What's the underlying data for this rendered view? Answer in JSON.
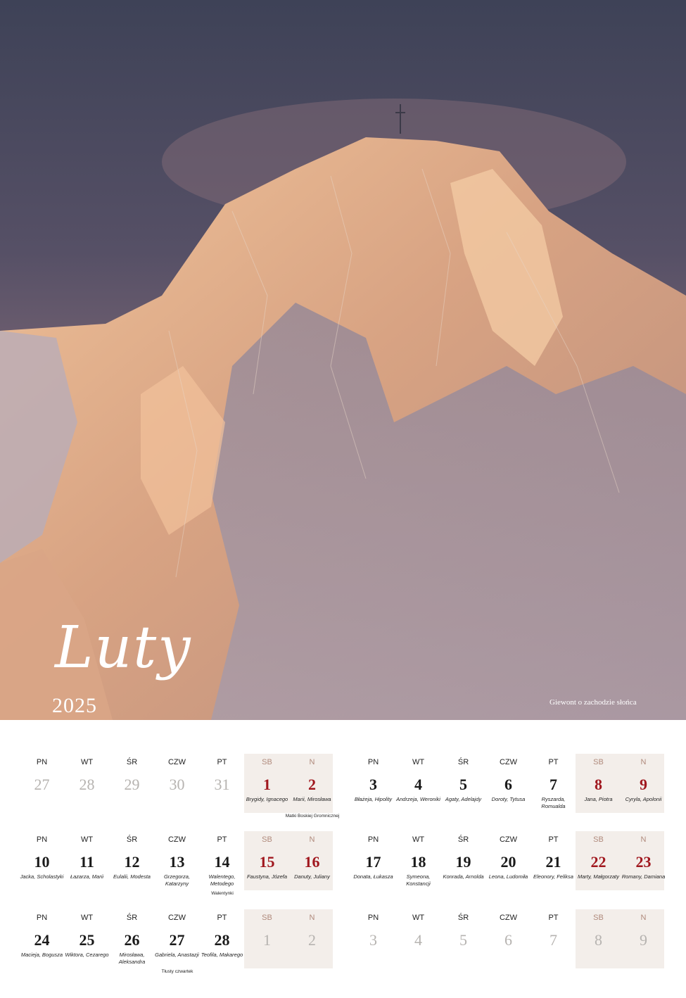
{
  "month": "Luty",
  "year": "2025",
  "caption": "Giewont o zachodzie słońca",
  "colors": {
    "sky": "#4b4f64",
    "rock_light": "#e9b88f",
    "weekend_bg": "#f3eeea",
    "holiday_red": "#a0171e",
    "dim_gray": "#b6b3b0"
  },
  "weekdays": [
    "PN",
    "WT",
    "ŚR",
    "CZW",
    "PT",
    "SB",
    "N"
  ],
  "weeks": [
    {
      "days": [
        {
          "n": "27",
          "names": "",
          "style": "gray"
        },
        {
          "n": "28",
          "names": "",
          "style": "gray"
        },
        {
          "n": "29",
          "names": "",
          "style": "gray"
        },
        {
          "n": "30",
          "names": "",
          "style": "gray"
        },
        {
          "n": "31",
          "names": "",
          "style": "gray"
        },
        {
          "n": "1",
          "names": "Brygidy, Ignacego",
          "style": "red"
        },
        {
          "n": "2",
          "names": "Marii, Mirosława",
          "style": "red"
        }
      ],
      "note": {
        "day": 6,
        "text": "Matki Boskiej Gromnicznej"
      }
    },
    {
      "days": [
        {
          "n": "3",
          "names": "Błażeja, Hipolity",
          "style": "normal"
        },
        {
          "n": "4",
          "names": "Andrzeja, Weroniki",
          "style": "normal"
        },
        {
          "n": "5",
          "names": "Agaty, Adelajdy",
          "style": "normal"
        },
        {
          "n": "6",
          "names": "Doroty, Tytusa",
          "style": "normal"
        },
        {
          "n": "7",
          "names": "Ryszarda, Romualda",
          "style": "normal"
        },
        {
          "n": "8",
          "names": "Jana, Piotra",
          "style": "red"
        },
        {
          "n": "9",
          "names": "Cyryla, Apolonii",
          "style": "red"
        }
      ]
    },
    {
      "days": [
        {
          "n": "10",
          "names": "Jacka, Scholastyki",
          "style": "normal"
        },
        {
          "n": "11",
          "names": "Łazarza, Marii",
          "style": "normal"
        },
        {
          "n": "12",
          "names": "Eulalii, Modesta",
          "style": "normal"
        },
        {
          "n": "13",
          "names": "Grzegorza, Katarzyny",
          "style": "normal"
        },
        {
          "n": "14",
          "names": "Walentego, Metodego",
          "style": "normal"
        },
        {
          "n": "15",
          "names": "Faustyna, Józefa",
          "style": "red"
        },
        {
          "n": "16",
          "names": "Danuty, Juliany",
          "style": "red"
        }
      ],
      "note": {
        "day": 4,
        "text": "Walentynki"
      }
    },
    {
      "days": [
        {
          "n": "17",
          "names": "Donata, Łukasza",
          "style": "normal"
        },
        {
          "n": "18",
          "names": "Symeona, Konstancji",
          "style": "normal"
        },
        {
          "n": "19",
          "names": "Konrada, Arnolda",
          "style": "normal"
        },
        {
          "n": "20",
          "names": "Leona, Ludomiła",
          "style": "normal"
        },
        {
          "n": "21",
          "names": "Eleonory, Feliksa",
          "style": "normal"
        },
        {
          "n": "22",
          "names": "Marty, Małgorzaty",
          "style": "red"
        },
        {
          "n": "23",
          "names": "Romany, Damiana",
          "style": "red"
        }
      ]
    },
    {
      "days": [
        {
          "n": "24",
          "names": "Macieja, Bogusza",
          "style": "normal"
        },
        {
          "n": "25",
          "names": "Wiktora, Cezarego",
          "style": "normal"
        },
        {
          "n": "26",
          "names": "Mirosława, Aleksandra",
          "style": "normal"
        },
        {
          "n": "27",
          "names": "Gabriela, Anastazji",
          "style": "normal"
        },
        {
          "n": "28",
          "names": "Teofila, Makarego",
          "style": "normal"
        },
        {
          "n": "1",
          "names": "",
          "style": "gray"
        },
        {
          "n": "2",
          "names": "",
          "style": "gray"
        }
      ],
      "note": {
        "day": 3,
        "text": "Tłusty czwartek"
      }
    },
    {
      "days": [
        {
          "n": "3",
          "names": "",
          "style": "gray"
        },
        {
          "n": "4",
          "names": "",
          "style": "gray"
        },
        {
          "n": "5",
          "names": "",
          "style": "gray"
        },
        {
          "n": "6",
          "names": "",
          "style": "gray"
        },
        {
          "n": "7",
          "names": "",
          "style": "gray"
        },
        {
          "n": "8",
          "names": "",
          "style": "gray"
        },
        {
          "n": "9",
          "names": "",
          "style": "gray"
        }
      ]
    }
  ]
}
